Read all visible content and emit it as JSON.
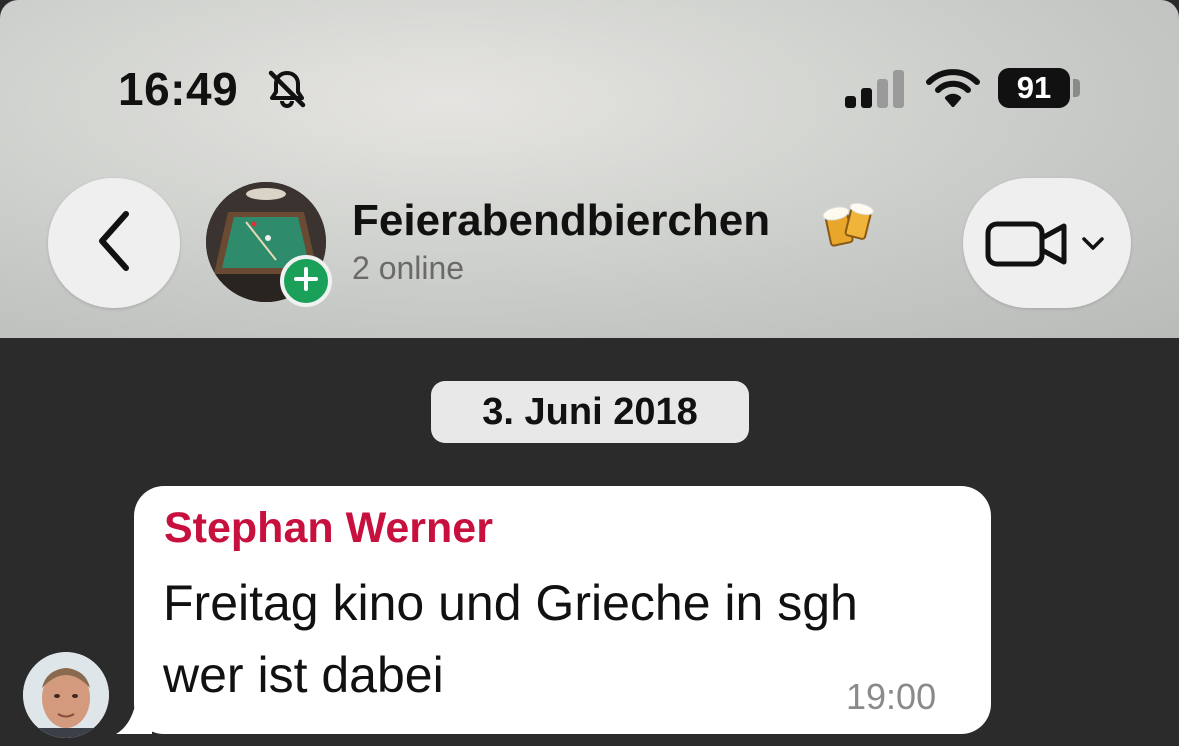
{
  "status_bar": {
    "time": "16:49",
    "battery": "91",
    "icons": [
      "bell-slash-icon",
      "cellular-signal-icon",
      "wifi-icon",
      "battery-icon"
    ]
  },
  "header": {
    "back_icon": "chevron-left-icon",
    "group_name": "Feierabendbierchen",
    "group_emoji": "beer-mugs-emoji",
    "subtitle": "2 online",
    "call_icon": "video-camera-icon"
  },
  "chat": {
    "date_label": "3. Juni 2018",
    "messages": [
      {
        "sender": "Stephan Werner",
        "lines": [
          "Freitag kino und Grieche in sgh",
          "wer ist dabei"
        ],
        "time": "19:00"
      }
    ]
  },
  "colors": {
    "sender_name": "#c8103e",
    "online_badge": "#1aa058",
    "chat_background": "#2b2b2b"
  }
}
